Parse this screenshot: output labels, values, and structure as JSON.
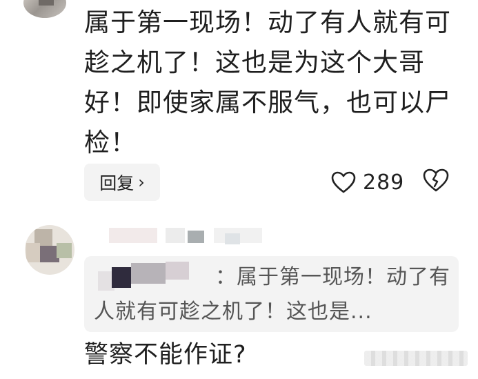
{
  "comment": {
    "text": "属于第一现场！动了有人就有可趁之机了！这也是为这个大哥好！即使家属不服气，也可以尸检！",
    "reply_label": "回复",
    "reply_chevron": "›",
    "like_count": "289",
    "like_icon": "heart-outline-icon",
    "dislike_icon": "broken-heart-icon"
  },
  "reply_comment": {
    "quote_text": "：属于第一现场！动了有人就有可趁之机了！这也是...",
    "text": "警察不能作证?"
  },
  "colors": {
    "text": "#1f1f1f",
    "quote_background": "#f3f3f3",
    "quote_text": "#555555"
  }
}
